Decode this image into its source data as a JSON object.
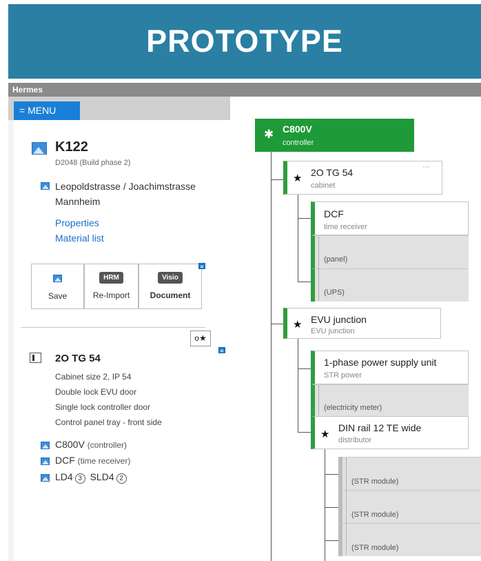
{
  "banner": {
    "title": "PROTOTYPE"
  },
  "window": {
    "title": "Hermes"
  },
  "menu": {
    "label": "= MENU"
  },
  "project": {
    "name": "K122",
    "subtitle": "D2048 (Build phase 2)",
    "address_line1": "Leopoldstrasse / Joachimstrasse",
    "address_line2": "Mannheim",
    "links": {
      "properties": "Properties",
      "material_list": "Material list"
    }
  },
  "actions": {
    "save": "Save",
    "reimport_badge": "HRM",
    "reimport": "Re-Import",
    "document_badge": "Visio",
    "document": "Document"
  },
  "star_filter": {
    "label": "o★"
  },
  "cabinet": {
    "title": "2O TG 54",
    "details": [
      "Cabinet size 2, IP 54",
      "Double lock EVU door",
      "Single lock controller door",
      "Control panel tray - front side"
    ]
  },
  "devices": [
    {
      "name": "C800V",
      "type": "(controller)"
    },
    {
      "name": "DCF",
      "type": "(time receiver)"
    }
  ],
  "modules": {
    "a": "LD4",
    "a_count": "3",
    "b": "SLD4",
    "b_count": "2"
  },
  "tree": {
    "root": {
      "title": "C800V",
      "type": "controller"
    },
    "cabinet": {
      "title": "2O TG 54",
      "type": "cabinet",
      "more": "···"
    },
    "dcf": {
      "title": "DCF",
      "type": "time receiver"
    },
    "panel": "(panel)",
    "ups": "(UPS)",
    "evu": {
      "title": "EVU junction",
      "type": "EVU junction"
    },
    "psu": {
      "title": "1-phase power supply unit",
      "type": "STR power"
    },
    "meter": "(electricity meter)",
    "din": {
      "title": "DIN rail 12 TE wide",
      "type": "distributor"
    },
    "str_modules": [
      "(STR module)",
      "(STR module)",
      "(STR module)"
    ]
  },
  "colors": {
    "accent_green": "#2e9e3e",
    "banner_blue": "#2a7fa3",
    "menu_blue": "#1a7fd6"
  }
}
